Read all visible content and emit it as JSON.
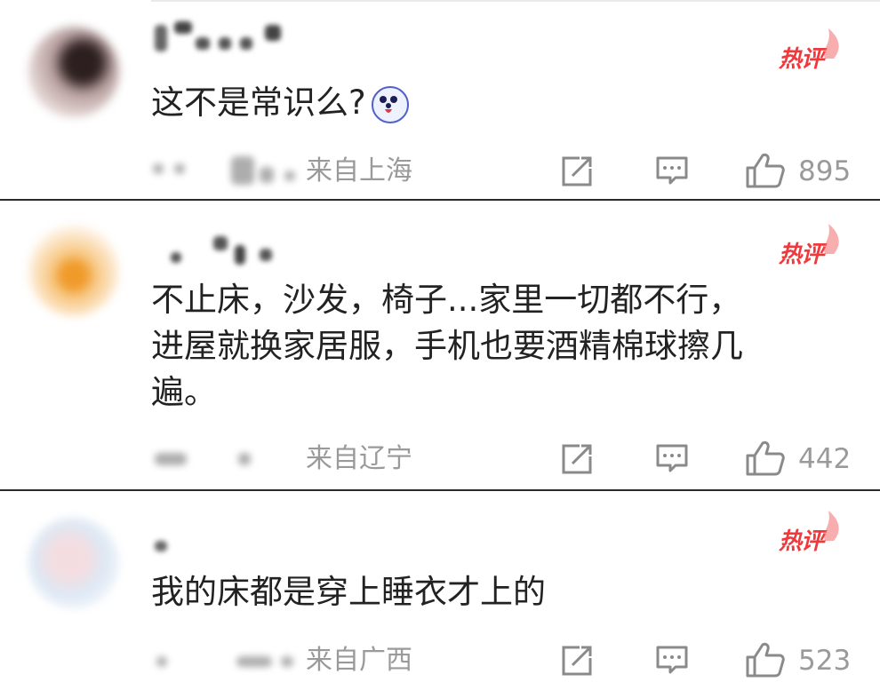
{
  "hot_label": "热评",
  "comments": [
    {
      "text_lines": [
        "这不是常识么?"
      ],
      "location": "来自上海",
      "likes": "895",
      "avatar_colors": [
        "#c7b0b0",
        "#3a2a2a",
        "#d9c6c4"
      ]
    },
    {
      "text_lines": [
        "不止床，沙发，椅子...家里一切都不行，",
        "进屋就换家居服，手机也要酒精棉球擦几",
        "遍。"
      ],
      "location": "来自辽宁",
      "likes": "442",
      "avatar_colors": [
        "#f6dcb0",
        "#f0a040",
        "#fde7cf"
      ]
    },
    {
      "text_lines": [
        "我的床都是穿上睡衣才上的"
      ],
      "location": "来自广西",
      "likes": "523",
      "avatar_colors": [
        "#d8e4f2",
        "#f0d8dc",
        "#e8eef6"
      ]
    }
  ],
  "colors": {
    "hot_red": "#f0393c",
    "text": "#222222",
    "meta": "#9a9a9a",
    "divider": "#2a2a2a"
  },
  "icons": {
    "share": "share-icon",
    "comment": "comment-icon",
    "like": "thumbs-up-icon",
    "emoji": "husky-emoji-icon",
    "hot": "flame-icon"
  }
}
